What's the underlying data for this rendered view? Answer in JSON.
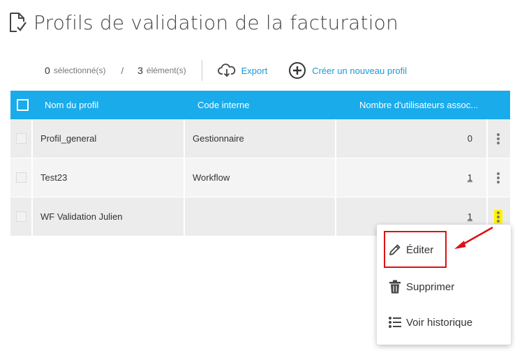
{
  "page": {
    "title": "Profils de validation de la facturation"
  },
  "toolbar": {
    "selected_count": "0",
    "selected_label": "sélectionné(s)",
    "separator": "/",
    "total_count": "3",
    "total_label": "élément(s)",
    "export_label": "Export",
    "create_label": "Créer un nouveau profil"
  },
  "table": {
    "headers": {
      "name": "Nom du profil",
      "code": "Code interne",
      "users": "Nombre d'utilisateurs assoc..."
    },
    "rows": [
      {
        "name": "Profil_general",
        "code": "Gestionnaire",
        "users": "0"
      },
      {
        "name": "Test23",
        "code": "Workflow",
        "users": "1"
      },
      {
        "name": "WF Validation Julien",
        "code": "",
        "users": "1"
      }
    ]
  },
  "context_menu": {
    "edit": "Éditer",
    "delete": "Supprimer",
    "history": "Voir historique"
  },
  "colors": {
    "header_bg": "#1aabeb",
    "link": "#1a9ad6",
    "active_kebab": "#fff200",
    "annotation_red": "#dd1111"
  }
}
